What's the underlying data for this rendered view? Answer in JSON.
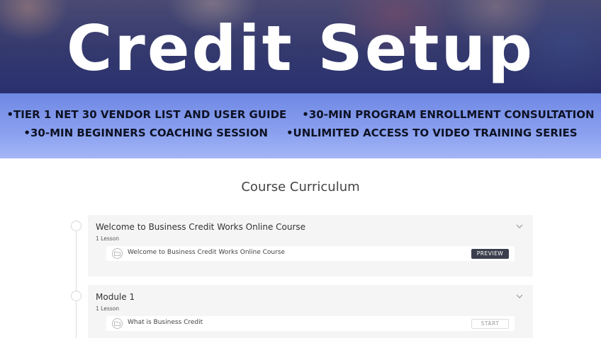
{
  "hero": {
    "title": "Credit Setup"
  },
  "features": {
    "row1": [
      "TIER 1 NET 30 VENDOR LIST AND USER GUIDE",
      "30-MIN PROGRAM ENROLLMENT CONSULTATION"
    ],
    "row2": [
      "30-MIN BEGINNERS COACHING SESSION",
      "UNLIMITED ACCESS TO VIDEO TRAINING SERIES"
    ]
  },
  "curriculum": {
    "title": "Course Curriculum",
    "sections": [
      {
        "title": "Welcome to Business Credit Works Online Course",
        "count": "1 Lesson",
        "lessons": [
          {
            "title": "Welcome to Business Credit Works Online Course",
            "action": "PREVIEW"
          }
        ]
      },
      {
        "title": "Module 1",
        "count": "1 Lesson",
        "lessons": [
          {
            "title": "What is Business Credit",
            "action": "START"
          }
        ]
      }
    ]
  },
  "icons": {
    "expand": "chevron-down-icon",
    "lesson": "folder-icon"
  },
  "colors": {
    "band": "#8aa0ef",
    "preview_button": "#3b3e4c",
    "hero_text": "#ffffff"
  }
}
